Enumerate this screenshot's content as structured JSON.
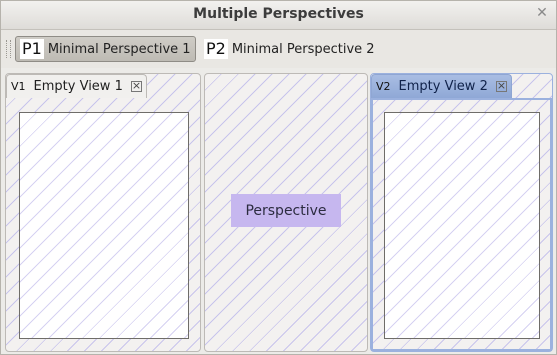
{
  "window": {
    "title": "Multiple Perspectives"
  },
  "toolbar": {
    "perspectives": [
      {
        "icon": "P1",
        "label": "Minimal Perspective 1",
        "active": true
      },
      {
        "icon": "P2",
        "label": "Minimal Perspective 2",
        "active": false
      }
    ]
  },
  "views": {
    "left": {
      "icon": "V1",
      "title": "Empty View 1"
    },
    "center": {
      "label": "Perspective"
    },
    "right": {
      "icon": "V2",
      "title": "Empty View 2"
    }
  },
  "colors": {
    "hatch": "#c8c4ec",
    "perspective_label_bg": "#c6b7ef",
    "active_tab": "#9bb1de"
  }
}
